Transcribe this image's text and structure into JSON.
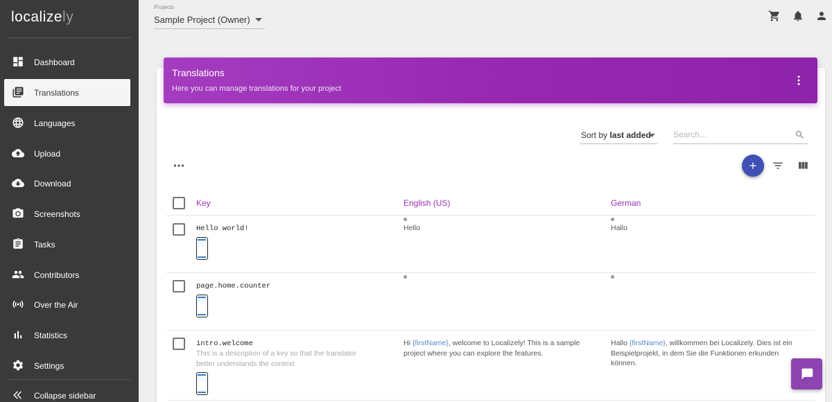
{
  "app": {
    "logo_main": "localize",
    "logo_accent": "ly"
  },
  "sidebar": {
    "items": [
      {
        "label": "Dashboard",
        "icon": "dashboard-icon"
      },
      {
        "label": "Translations",
        "icon": "translations-icon",
        "active": true
      },
      {
        "label": "Languages",
        "icon": "globe-icon"
      },
      {
        "label": "Upload",
        "icon": "cloud-upload-icon"
      },
      {
        "label": "Download",
        "icon": "cloud-download-icon"
      },
      {
        "label": "Screenshots",
        "icon": "camera-icon"
      },
      {
        "label": "Tasks",
        "icon": "clipboard-icon"
      },
      {
        "label": "Contributors",
        "icon": "people-icon"
      },
      {
        "label": "Over the Air",
        "icon": "broadcast-icon"
      },
      {
        "label": "Statistics",
        "icon": "bar-chart-icon"
      },
      {
        "label": "Settings",
        "icon": "gear-icon"
      }
    ],
    "collapse_label": "Collapse sidebar"
  },
  "topbar": {
    "projects_caption": "Projects",
    "project_value": "Sample Project (Owner)",
    "icons": [
      "cart-icon",
      "bell-icon",
      "account-icon"
    ]
  },
  "banner": {
    "title": "Translations",
    "subtitle": "Here you can manage translations for your project"
  },
  "toolbar": {
    "sort_prefix": "Sort by ",
    "sort_value": "last added",
    "search_placeholder": "Search..."
  },
  "table": {
    "headers": {
      "key": "Key",
      "lang1": "English (US)",
      "lang2": "German"
    },
    "rows": [
      {
        "key": "Hello world!",
        "description": "",
        "lang1": "Hello",
        "lang2": "Hallo"
      },
      {
        "key": "page.home.counter",
        "description": "",
        "lang1": "",
        "lang2": ""
      },
      {
        "key": "intro.welcome",
        "description": "This is a description of a key so that the translator better understands the context",
        "lang1_pre": "Hi ",
        "lang1_ph": "{firstName}",
        "lang1_post": ", welcome to Localizely! This is a sample project where you can explore the features.",
        "lang2_pre": "Hallo ",
        "lang2_ph": "{firstName}",
        "lang2_post": ", willkommen bei Localizely. Dies ist ein Beispielprojekt, in dem Sie die Funktionen erkunden können."
      }
    ]
  },
  "colors": {
    "sidebar_bg": "#3a3a3a",
    "accent_purple": "#9627b0",
    "fab_blue": "#3f51b5",
    "placeholder_blue": "#5c86c9"
  }
}
